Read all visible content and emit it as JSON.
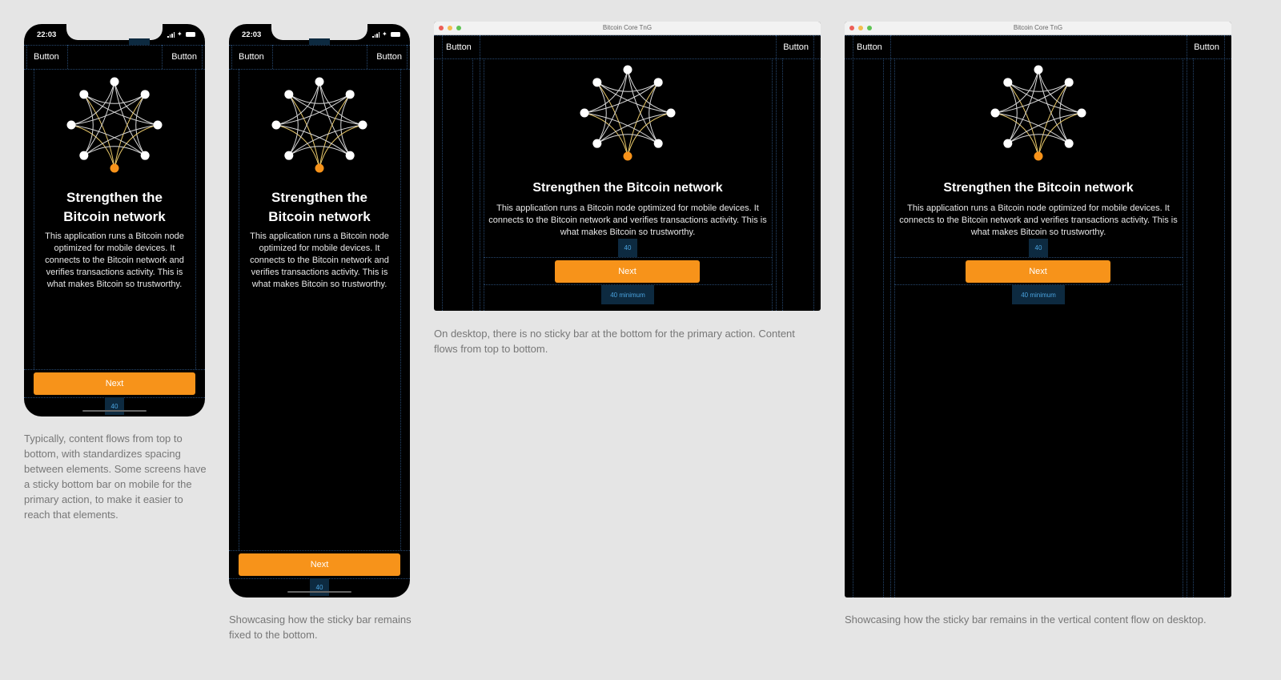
{
  "colors": {
    "accent": "#f7931a",
    "background": "#e5e5e5",
    "screen": "#000000",
    "guide": "#4682c8"
  },
  "status_bar": {
    "time": "22:03",
    "icons": [
      "signal-icon",
      "wifi-icon",
      "battery-icon"
    ]
  },
  "window": {
    "title": "Bitcoin Core TnG"
  },
  "header": {
    "left_button": "Button",
    "right_button": "Button"
  },
  "hero": {
    "title": "Strengthen the Bitcoin network",
    "body": "This application runs a Bitcoin node optimized for mobile devices. It connects to the Bitcoin network and verifies transactions activity. This is what makes Bitcoin so trustworthy."
  },
  "primary_action": {
    "label": "Next"
  },
  "spacing": {
    "mobile_bottom": "40",
    "desktop_gap": "40",
    "desktop_bottom": "40 minimum"
  },
  "captions": {
    "mobile_typical": "Typically, content flows from top to bottom, with standardizes spacing between elements. Some screens have a sticky bottom bar on mobile for the primary action, to make it easier to reach that elements.",
    "mobile_sticky": "Showcasing how the sticky bar remains fixed to the bottom.",
    "desktop_flow": "On desktop, there is no sticky bar at the bottom for the primary action. Content flows from top to bottom.",
    "desktop_sticky": "Showcasing how the sticky bar remains in the vertical content flow on desktop."
  }
}
